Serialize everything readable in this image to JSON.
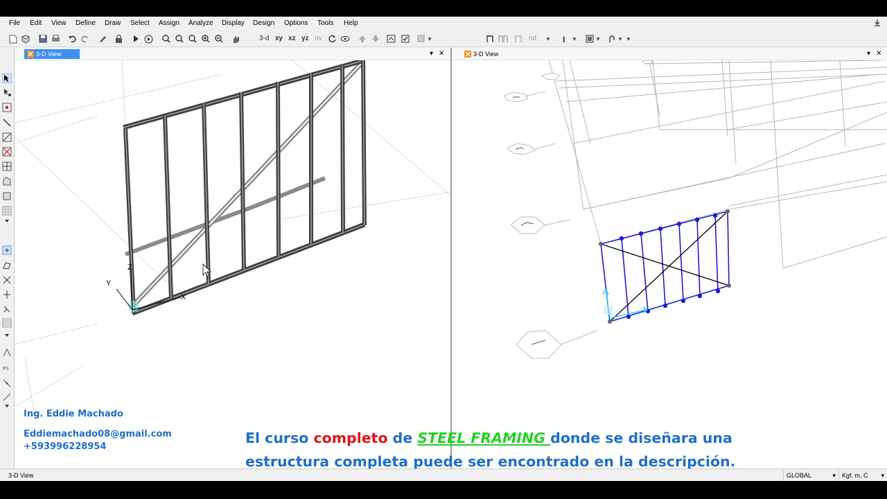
{
  "menu": [
    "File",
    "Edit",
    "View",
    "Define",
    "Draw",
    "Select",
    "Assign",
    "Analyze",
    "Display",
    "Design",
    "Options",
    "Tools",
    "Help"
  ],
  "toolbar": {
    "view_3d": "3-d",
    "view_xy": "xy",
    "view_xz": "xz",
    "view_yz": "yz",
    "view_nv": "nv",
    "nd": "nd",
    "text_tool": "I"
  },
  "panes": {
    "left": {
      "title": "3-D View",
      "active": true
    },
    "right": {
      "title": "3-D View",
      "active": false
    }
  },
  "axes": {
    "x": "X",
    "y": "Y",
    "z": "Z"
  },
  "overlay": {
    "author_name": "Ing. Eddie Machado",
    "email": "Eddiemachado08@gmail.com",
    "phone": "+593996228954",
    "message_part1": "El curso ",
    "message_highlight": "completo",
    "message_part2": " de ",
    "message_brand": "STEEL FRAMING ",
    "message_part3": " donde se diseñara una estructura completa puede ser encontrado en la descripción."
  },
  "status": {
    "left": "3-D View",
    "coord_system": "GLOBAL",
    "units": "Kgf, m, C"
  },
  "colors": {
    "active_tab": "#3d8ff0",
    "frame_selected": "#1b1bd6",
    "overlay_blue": "#1f6fc8",
    "overlay_red": "#e2141c",
    "overlay_green": "#22d126"
  }
}
